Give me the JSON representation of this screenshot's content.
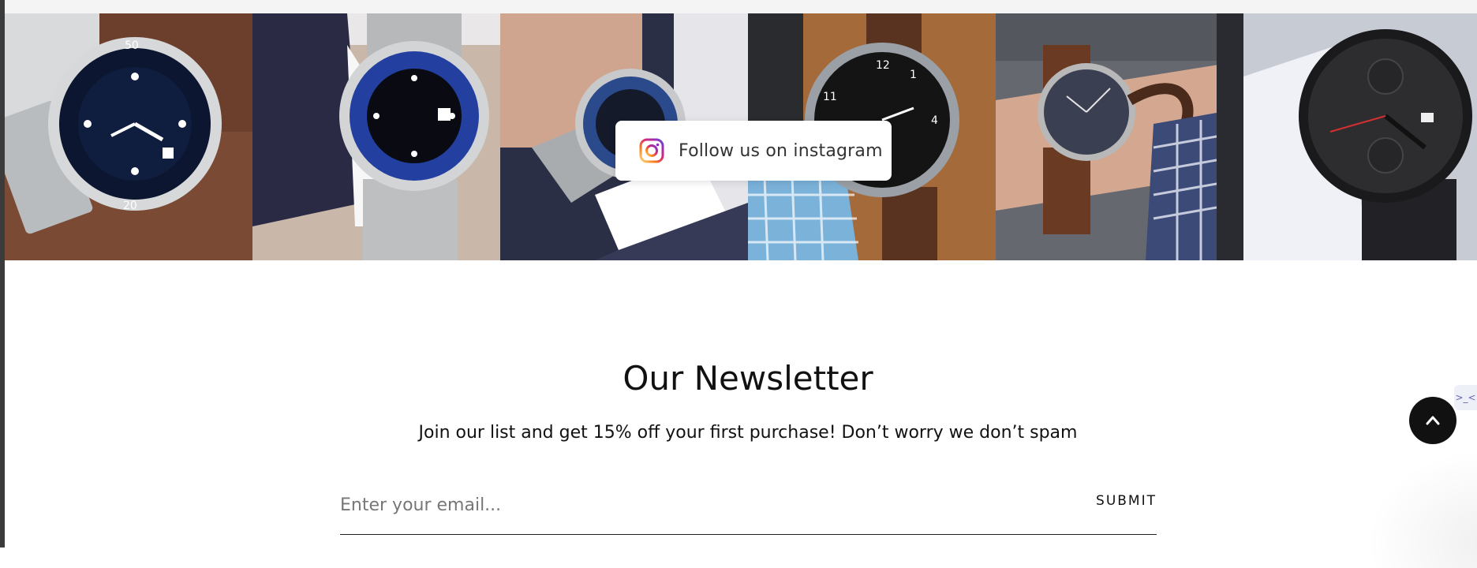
{
  "instagram": {
    "follow_label": "Follow us on instagram",
    "icon": "instagram-icon",
    "photos": [
      {
        "icon": "watch-photo",
        "dial_color": "#0f1d3f",
        "bezel_color": "#0c1630",
        "bg_color": "#6b3f2b"
      },
      {
        "icon": "watch-photo",
        "dial_color": "#0a0a12",
        "bezel_color": "#2340a0",
        "bg_color": "#c9b8aa"
      },
      {
        "icon": "watch-photo",
        "dial_color": "#141a2a",
        "bezel_color": "#2b4a8c",
        "bg_color": "#2a2f45"
      },
      {
        "icon": "watch-photo",
        "dial_color": "#141414",
        "bezel_color": "#9aa0a6",
        "bg_color": "#a56a3a"
      },
      {
        "icon": "watch-photo",
        "dial_color": "#3b3f52",
        "bezel_color": "#b8b8b8",
        "bg_color": "#666870"
      },
      {
        "icon": "watch-photo",
        "dial_color": "#2d2d2f",
        "bezel_color": "#1a1a1c",
        "bg_color": "#c7cbd3"
      }
    ]
  },
  "newsletter": {
    "title": "Our Newsletter",
    "subtitle": "Join our list and get 15% off your first purchase! Don’t worry we don’t spam",
    "email_placeholder": "Enter your email...",
    "submit_label": "SUBMIT"
  },
  "widgets": {
    "back_to_top_icon": "chevron-up-icon",
    "side_tab_text": ">_<"
  },
  "colors": {
    "accent": "#111111",
    "instagram_gradient": [
      "#feda75",
      "#fa7e1e",
      "#d62976",
      "#962fbf",
      "#4f5bd5"
    ]
  }
}
